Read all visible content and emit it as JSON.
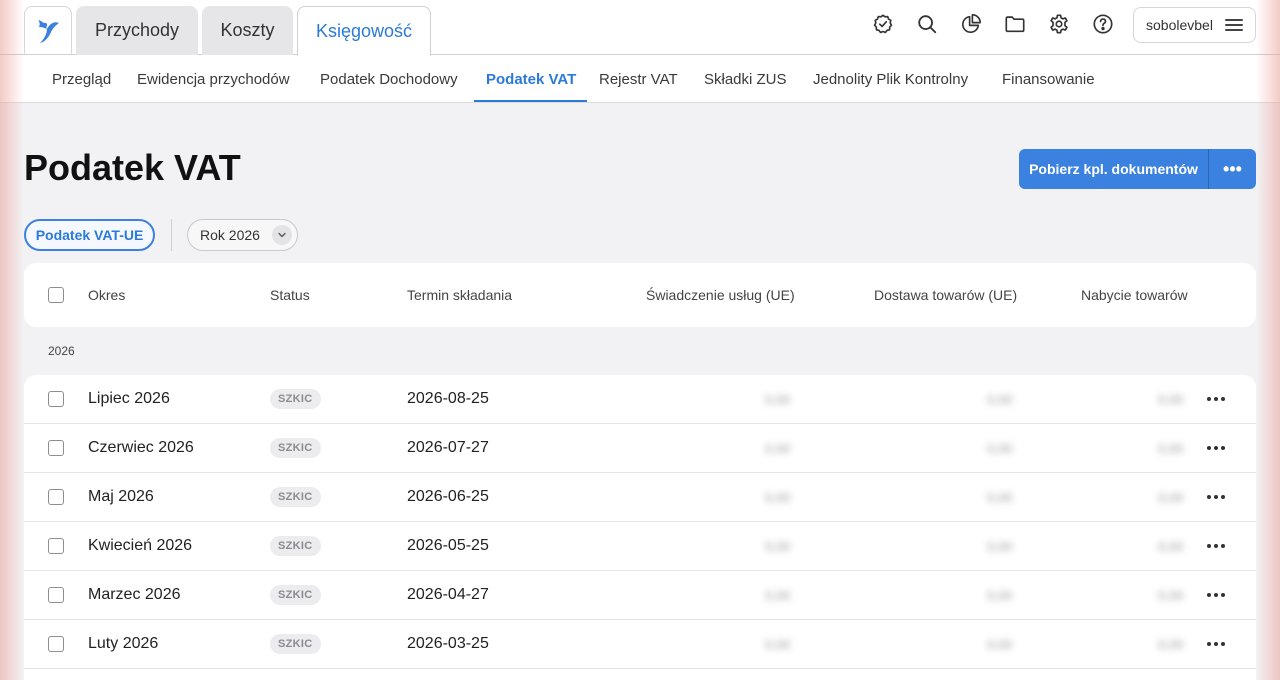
{
  "header": {
    "tabs": [
      {
        "label": "Przychody"
      },
      {
        "label": "Koszty"
      },
      {
        "label": "Księgowość"
      }
    ],
    "user": {
      "name": "sobolevbel"
    },
    "icons": [
      "badge-check-icon",
      "search-icon",
      "pie-chart-icon",
      "folder-icon",
      "settings-icon",
      "help-icon",
      "menu-icon"
    ]
  },
  "subnav": {
    "items": [
      {
        "label": "Przegląd"
      },
      {
        "label": "Ewidencja przychodów"
      },
      {
        "label": "Podatek Dochodowy"
      },
      {
        "label": "Podatek VAT"
      },
      {
        "label": "Rejestr VAT"
      },
      {
        "label": "Składki ZUS"
      },
      {
        "label": "Jednolity Plik Kontrolny"
      },
      {
        "label": "Finansowanie"
      }
    ],
    "active": "Podatek VAT"
  },
  "page": {
    "title": "Podatek VAT",
    "primary_button": "Pobierz kpl. dokumentów",
    "more_button": "•••"
  },
  "filters": {
    "chip": "Podatek VAT-UE",
    "year": "Rok 2026"
  },
  "table": {
    "columns": [
      "Okres",
      "Status",
      "Termin składania",
      "Świadczenie usług (UE)",
      "Dostawa towarów (UE)",
      "Nabycie towarów"
    ],
    "group": "2026",
    "rows": [
      {
        "period": "Lipiec 2026",
        "status": "SZKIC",
        "deadline": "2026-08-25",
        "v1": "0,00",
        "v2": "0,00",
        "v3": "0,00"
      },
      {
        "period": "Czerwiec 2026",
        "status": "SZKIC",
        "deadline": "2026-07-27",
        "v1": "0,00",
        "v2": "0,00",
        "v3": "0,00"
      },
      {
        "period": "Maj 2026",
        "status": "SZKIC",
        "deadline": "2026-06-25",
        "v1": "0,00",
        "v2": "0,00",
        "v3": "0,00"
      },
      {
        "period": "Kwiecień 2026",
        "status": "SZKIC",
        "deadline": "2026-05-25",
        "v1": "0,00",
        "v2": "0,00",
        "v3": "0,00"
      },
      {
        "period": "Marzec 2026",
        "status": "SZKIC",
        "deadline": "2026-04-27",
        "v1": "0,00",
        "v2": "0,00",
        "v3": "0,00"
      },
      {
        "period": "Luty 2026",
        "status": "SZKIC",
        "deadline": "2026-03-25",
        "v1": "0,00",
        "v2": "0,00",
        "v3": "0,00"
      }
    ]
  },
  "colors": {
    "accent": "#2b7ad8",
    "primary_button": "#3b82e0"
  }
}
